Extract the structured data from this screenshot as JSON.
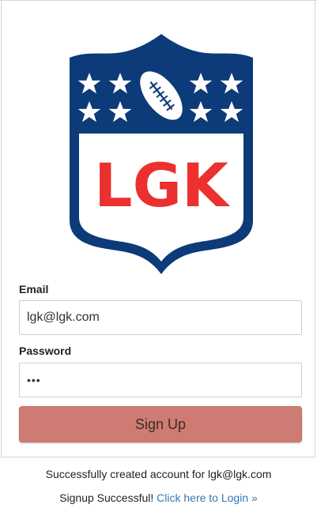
{
  "logo": {
    "text": "LGK",
    "shield_color": "#0d3a78",
    "text_color": "#ec2f2f",
    "star_color": "#ffffff"
  },
  "form": {
    "email_label": "Email",
    "email_value": "lgk@lgk.com",
    "password_label": "Password",
    "password_value": "•••",
    "signup_label": "Sign Up"
  },
  "messages": {
    "created": "Successfully created account for lgk@lgk.com",
    "success_prefix": "Signup Successful!",
    "login_link": "Click here to Login »"
  }
}
